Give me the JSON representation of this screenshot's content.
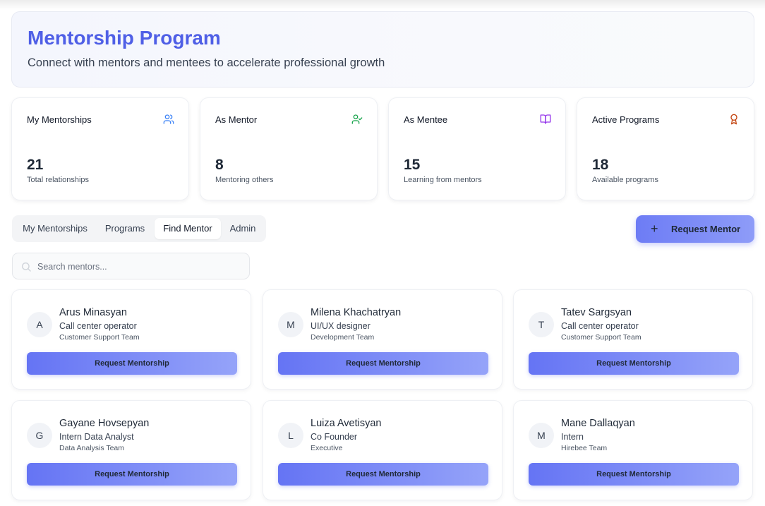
{
  "header": {
    "title": "Mentorship Program",
    "subtitle": "Connect with mentors and mentees to accelerate professional growth"
  },
  "stats": [
    {
      "title": "My Mentorships",
      "value": "21",
      "sub": "Total relationships",
      "icon": "users-icon",
      "color": "#3b82f6"
    },
    {
      "title": "As Mentor",
      "value": "8",
      "sub": "Mentoring others",
      "icon": "user-check-icon",
      "color": "#16a34a"
    },
    {
      "title": "As Mentee",
      "value": "15",
      "sub": "Learning from mentors",
      "icon": "book-open-icon",
      "color": "#9333ea"
    },
    {
      "title": "Active Programs",
      "value": "18",
      "sub": "Available programs",
      "icon": "award-icon",
      "color": "#c2410c"
    }
  ],
  "tabs": [
    {
      "label": "My Mentorships",
      "active": false
    },
    {
      "label": "Programs",
      "active": false
    },
    {
      "label": "Find Mentor",
      "active": true
    },
    {
      "label": "Admin",
      "active": false
    }
  ],
  "request_mentor_label": "Request Mentor",
  "search": {
    "placeholder": "Search mentors..."
  },
  "mentors": [
    {
      "initial": "A",
      "name": "Arus Minasyan",
      "role": "Call center operator",
      "team": "Customer Support Team",
      "button": "Request Mentorship"
    },
    {
      "initial": "M",
      "name": "Milena Khachatryan",
      "role": "UI/UX designer",
      "team": "Development Team",
      "button": "Request Mentorship"
    },
    {
      "initial": "T",
      "name": "Tatev Sargsyan",
      "role": "Call center operator",
      "team": "Customer Support Team",
      "button": "Request Mentorship"
    },
    {
      "initial": "G",
      "name": "Gayane Hovsepyan",
      "role": "Intern Data Analyst",
      "team": "Data Analysis Team",
      "button": "Request Mentorship"
    },
    {
      "initial": "L",
      "name": "Luiza Avetisyan",
      "role": "Co Founder",
      "team": "Executive",
      "button": "Request Mentorship"
    },
    {
      "initial": "M",
      "name": "Mane Dallaqyan",
      "role": "Intern",
      "team": "Hirebee Team",
      "button": "Request Mentorship"
    }
  ]
}
